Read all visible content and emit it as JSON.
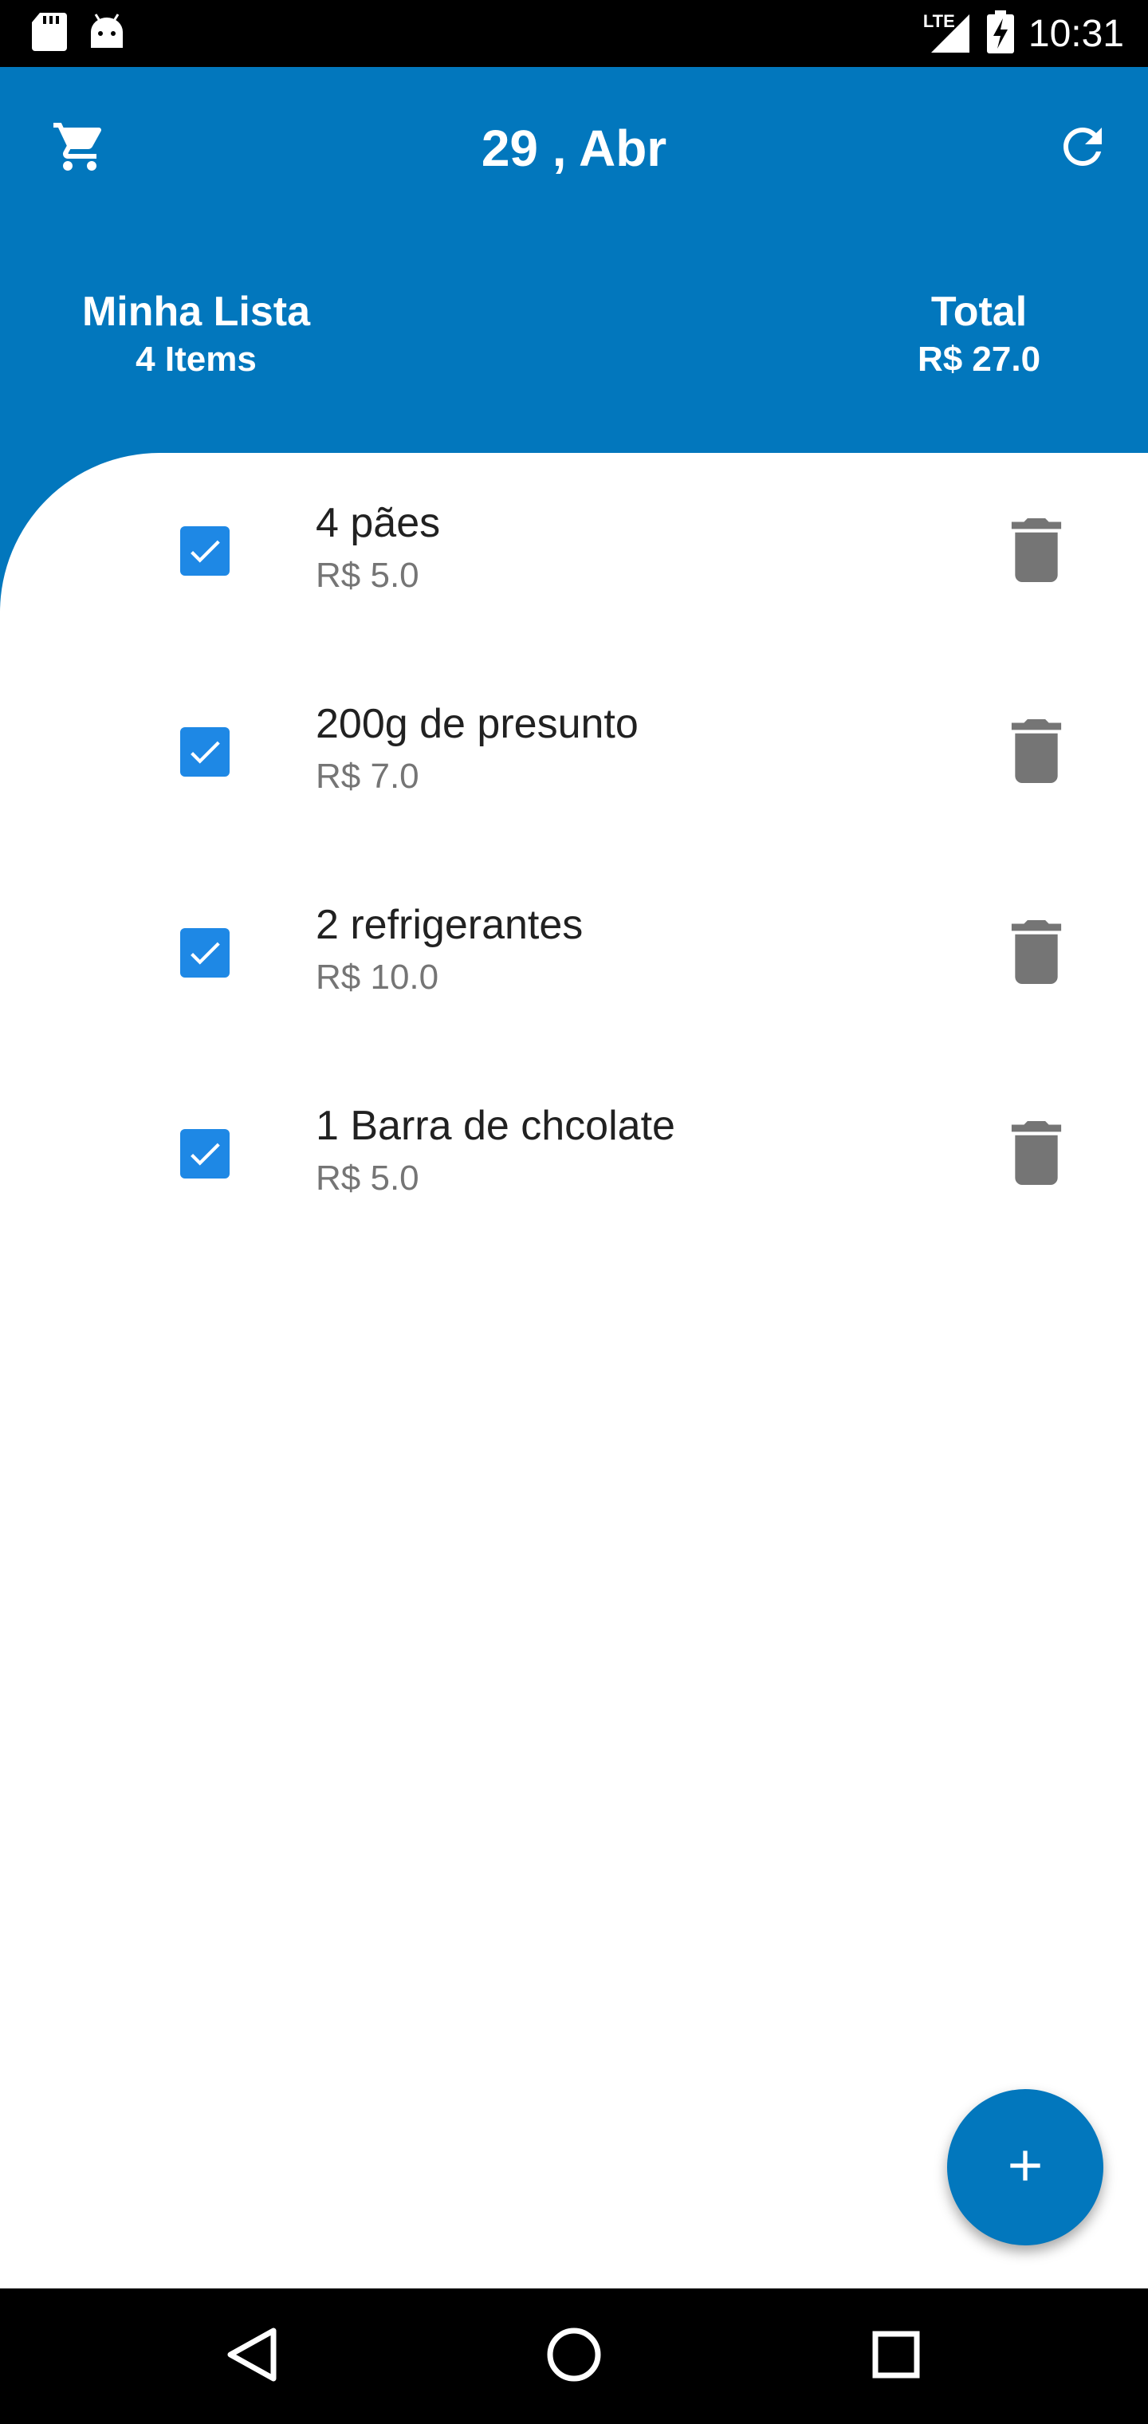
{
  "status_bar": {
    "time": "10:31",
    "network": "LTE",
    "icons": [
      "sd-card-icon",
      "android-icon",
      "signal-icon",
      "battery-charging-icon"
    ]
  },
  "header": {
    "date_title": "29 , Abr",
    "left_icon": "cart-icon",
    "right_icon": "refresh-icon",
    "list_name": "Minha Lista",
    "item_count": "4 Items",
    "total_label": "Total",
    "total_value": "R$ 27.0"
  },
  "items": [
    {
      "name": "4 pães",
      "price": "R$ 5.0",
      "checked": true
    },
    {
      "name": "200g de presunto",
      "price": "R$ 7.0",
      "checked": true
    },
    {
      "name": "2 refrigerantes",
      "price": "R$ 10.0",
      "checked": true
    },
    {
      "name": "1 Barra de chcolate",
      "price": "R$ 5.0",
      "checked": true
    }
  ],
  "fab": {
    "icon": "plus-icon"
  },
  "nav_bar": {
    "icons": [
      "back-icon",
      "home-icon",
      "recents-icon"
    ]
  },
  "colors": {
    "primary": "#0277bd",
    "checkbox": "#1e88e5",
    "delete_icon": "#757575",
    "text_primary": "#212121",
    "text_secondary": "#757575"
  }
}
